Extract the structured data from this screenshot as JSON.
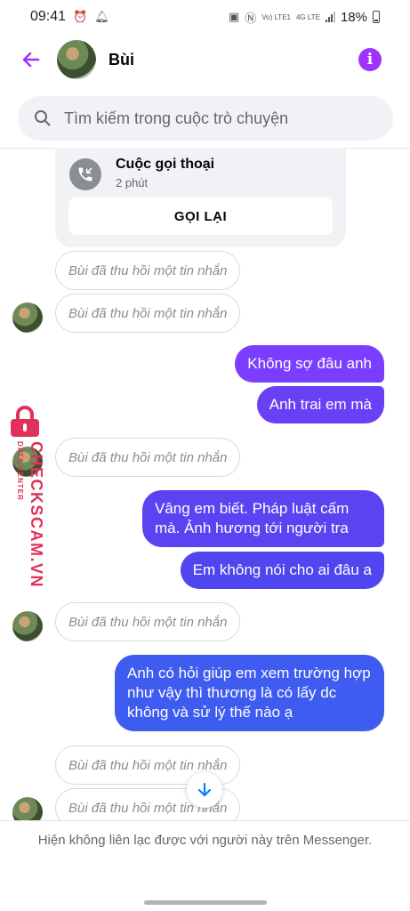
{
  "status_bar": {
    "time": "09:41",
    "battery": "18%",
    "network_label": "Vo) LTE1",
    "network_type": "4G LTE"
  },
  "header": {
    "contact_name": "Bùi",
    "back_icon": "back-arrow-icon",
    "info_icon": "info-icon"
  },
  "search": {
    "placeholder": "Tìm kiếm trong cuộc trò chuyện"
  },
  "call_card": {
    "title": "Cuộc gọi thoại",
    "duration": "2 phút",
    "callback_label": "GỌI LẠI"
  },
  "messages": {
    "recalled_text": "Bùi đã thu hồi một tin nhắn",
    "out_1": "Không sợ đâu anh",
    "out_2": "Anh trai em mà",
    "out_3": "Vâng em biết. Pháp luật cấm mà. Ảnh hương tới người tra",
    "out_4": "Em không nói cho ai đâu a",
    "out_5": "Anh có hỏi giúp em xem trường hợp như vậy thì thương là có lấy dc không và sử lý thế nào ạ"
  },
  "watermark": {
    "brand": "CHECKSCAM.VN",
    "tagline": "DATA CENTER"
  },
  "footer": {
    "notice": "Hiện không liên lạc được với người này trên Messenger."
  },
  "colors": {
    "accent": "#a033ff",
    "bubble_top": "#7b3dff",
    "bubble_bottom": "#3f5cf0",
    "watermark": "#e0315a"
  }
}
